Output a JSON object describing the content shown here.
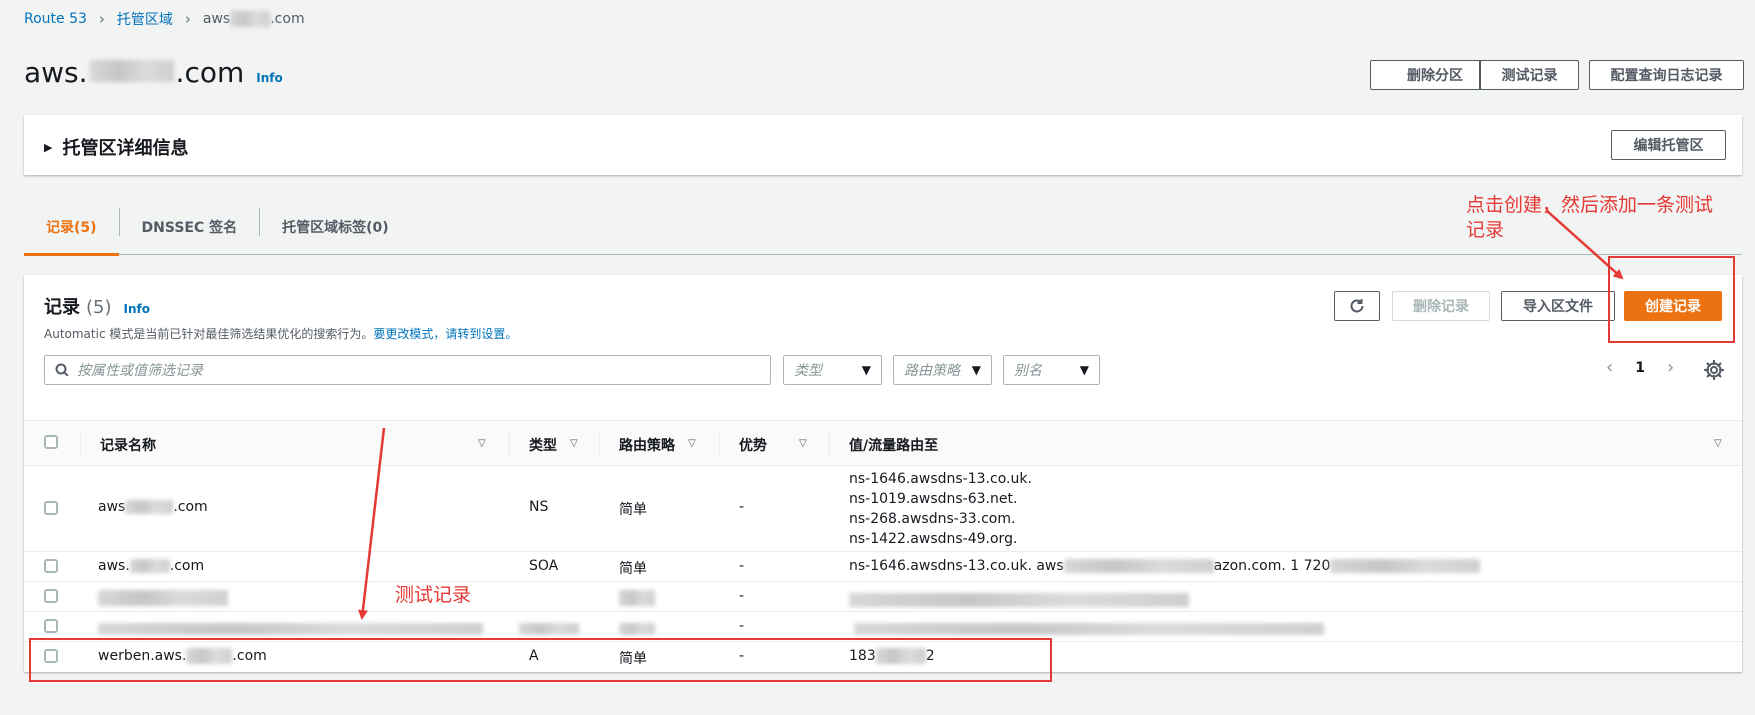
{
  "breadcrumb": {
    "root": "Route 53",
    "zones": "托管区域",
    "current_prefix": "aws",
    "current_suffix": ".com"
  },
  "header": {
    "title_prefix": "aws.",
    "title_suffix": ".com",
    "info": "Info",
    "buttons": {
      "delete_zone": "删除分区",
      "test_record": "测试记录",
      "query_logging": "配置查询日志记录"
    }
  },
  "details": {
    "title": "托管区详细信息",
    "edit_button": "编辑托管区"
  },
  "tabs": [
    {
      "label": "记录(5)",
      "active": true
    },
    {
      "label": "DNSSEC 签名",
      "active": false
    },
    {
      "label": "托管区域标签(0)",
      "active": false
    }
  ],
  "records": {
    "title": "记录",
    "count": "(5)",
    "info": "Info",
    "description": "Automatic 模式是当前已针对最佳筛选结果优化的搜索行为。",
    "description_link": "要更改模式，请转到设置。",
    "buttons": {
      "delete": "删除记录",
      "import": "导入区文件",
      "create": "创建记录"
    },
    "search_placeholder": "按属性或值筛选记录",
    "filters": {
      "type": "类型",
      "routing": "路由策略",
      "alias": "别名"
    },
    "page": "1",
    "columns": {
      "name": "记录名称",
      "type": "类型",
      "routing": "路由策略",
      "advantage": "优势",
      "value": "值/流量路由至"
    },
    "rows": [
      {
        "name_prefix": "aws",
        "name_suffix": ".com",
        "type": "NS",
        "routing": "简单",
        "advantage": "-",
        "values": [
          "ns-1646.awsdns-13.co.uk.",
          "ns-1019.awsdns-63.net.",
          "ns-268.awsdns-33.com.",
          "ns-1422.awsdns-49.org."
        ]
      },
      {
        "name_prefix": "aws.",
        "name_suffix": ".com",
        "type": "SOA",
        "routing": "简单",
        "advantage": "-",
        "value_prefix": "ns-1646.awsdns-13.co.uk. aws",
        "value_mid": "azon.com. 1 720"
      },
      {
        "name_prefix": "",
        "type": "",
        "routing": "",
        "advantage": "-"
      },
      {
        "name_prefix": "",
        "type": "",
        "routing": "",
        "advantage": "-"
      },
      {
        "name_prefix": "werben.aws.",
        "name_suffix": ".com",
        "type": "A",
        "routing": "简单",
        "advantage": "-",
        "value_prefix": "183",
        "value_suffix": "2"
      }
    ]
  },
  "annotations": {
    "create_hint": [
      "点击创建，然后添加一条测试",
      "记录"
    ],
    "test_record_label": "测试记录",
    "color": "#e53935"
  },
  "colors": {
    "primary": "#ec7211",
    "link": "#0073bb",
    "text": "#16191f"
  }
}
